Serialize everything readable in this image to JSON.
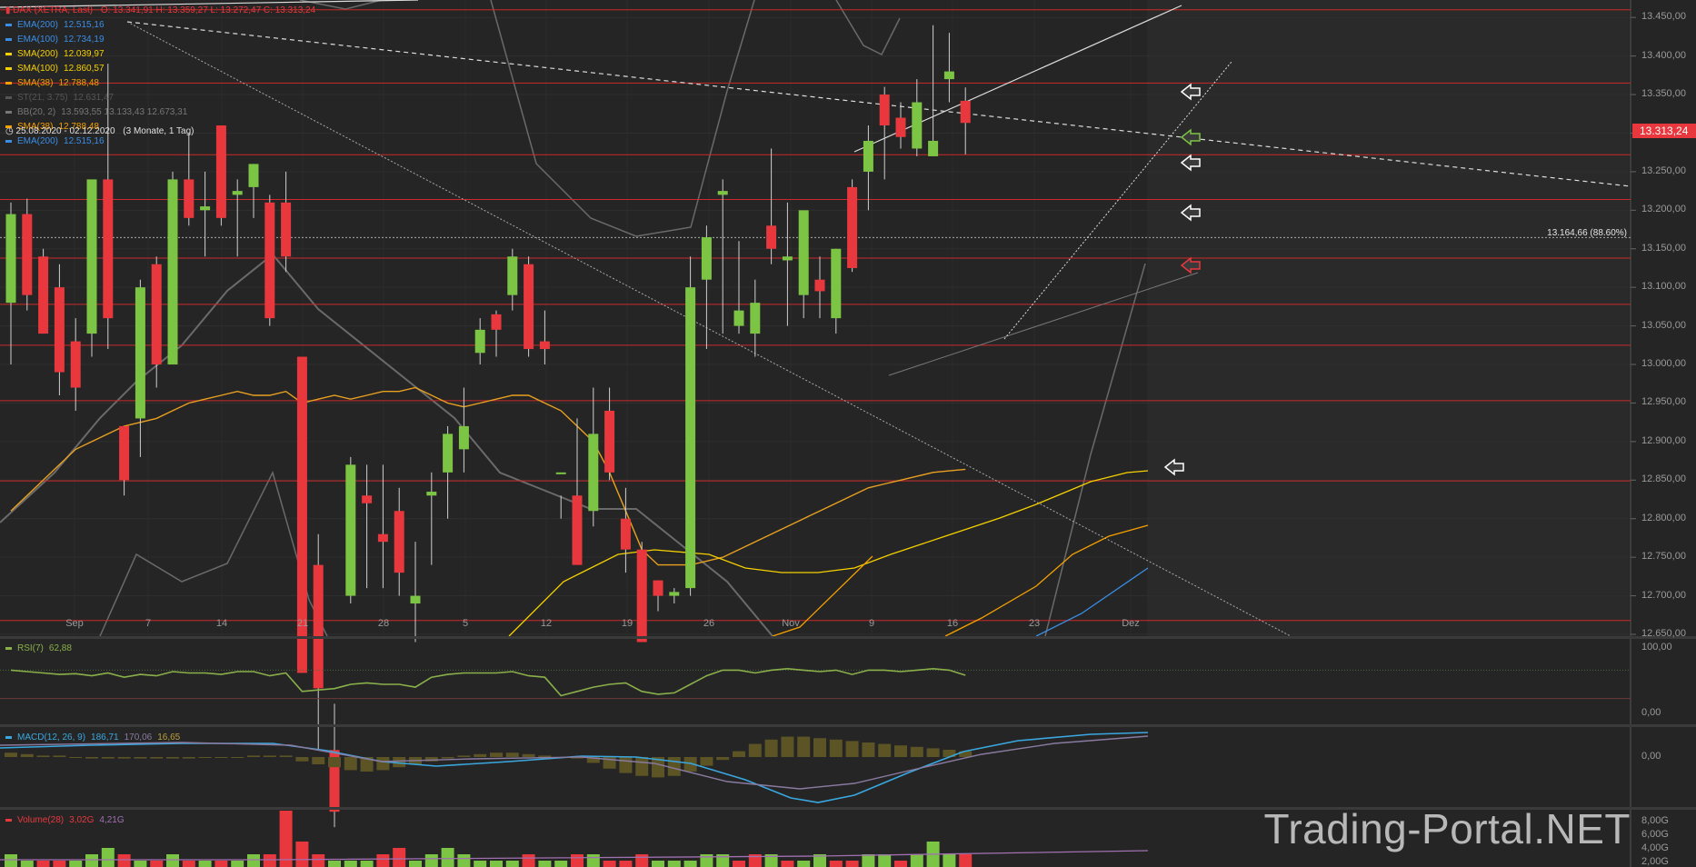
{
  "header": {
    "instrument": "DAX (XETRA, Last)",
    "ohlc": "O: 13.341,91  H: 13.359,27  L: 13.272,47  C: 13.313,24",
    "date_range": "25.08.2020 - 02.12.2020",
    "range_desc": "(3 Monate, 1 Tag)"
  },
  "indicators": [
    {
      "name": "EMA(200)",
      "value": "12.515,16",
      "color": "#3a8ee6"
    },
    {
      "name": "EMA(100)",
      "value": "12.734,19",
      "color": "#3a8ee6"
    },
    {
      "name": "SMA(200)",
      "value": "12.039,97",
      "color": "#f5d000"
    },
    {
      "name": "SMA(100)",
      "value": "12.860,57",
      "color": "#f5d000"
    },
    {
      "name": "SMA(38)",
      "value": "12.788,48",
      "color": "#f5a000"
    },
    {
      "name": "ST(21, 3.75)",
      "value": "12.631,47",
      "color": "#555555"
    },
    {
      "name": "BB(20, 2)",
      "value": "13.593,55  13.133,43  12.673,31",
      "color": "#777777"
    },
    {
      "name": "SMA(38)",
      "value": "12.788,48",
      "color": "#f5a000"
    },
    {
      "name": "EMA(200)",
      "value": "12.515,16",
      "color": "#3a8ee6"
    }
  ],
  "price_axis": {
    "ticks": [
      "13.450,00",
      "13.400,00",
      "13.350,00",
      "13.300,00",
      "13.250,00",
      "13.200,00",
      "13.150,00",
      "13.100,00",
      "13.050,00",
      "13.000,00",
      "12.950,00",
      "12.900,00",
      "12.850,00",
      "12.800,00",
      "12.750,00",
      "12.700,00",
      "12.650,00"
    ],
    "last_price": "13.313,24",
    "hline_label": "13.164,66 (88.60%)"
  },
  "date_axis": [
    "Sep",
    "7",
    "14",
    "21",
    "28",
    "5",
    "12",
    "19",
    "26",
    "Nov",
    "9",
    "16",
    "23",
    "Dez"
  ],
  "panels": {
    "rsi": {
      "name": "RSI(7)",
      "value": "62,88",
      "color": "#8ab04a",
      "ticks": [
        "100,00",
        "0,00"
      ]
    },
    "macd": {
      "name": "MACD(12, 26, 9)",
      "v1": "186,71",
      "v2": "170,06",
      "v3": "16,65",
      "c1": "#3aa8e0",
      "c2": "#8a7aa0",
      "c3": "#b8a040",
      "ticks": [
        "0,00"
      ]
    },
    "volume": {
      "name": "Volume(28)",
      "v1": "3,02G",
      "v2": "4,21G",
      "color": "#e8383d",
      "ticks": [
        "8,00G",
        "6,00G",
        "4,00G",
        "2,00G"
      ]
    }
  },
  "watermark": "Trading-Portal.NET",
  "chart_data": {
    "type": "candlestick",
    "title": "DAX (XETRA, Last)",
    "ylim": [
      12650,
      13480
    ],
    "candles": [
      {
        "o": 13080,
        "h": 13210,
        "l": 13000,
        "c": 13195
      },
      {
        "o": 13195,
        "h": 13215,
        "l": 13070,
        "c": 13090
      },
      {
        "o": 13140,
        "h": 13150,
        "l": 13040,
        "c": 13040
      },
      {
        "o": 13100,
        "h": 13130,
        "l": 12960,
        "c": 12990
      },
      {
        "o": 13030,
        "h": 13060,
        "l": 12940,
        "c": 12970
      },
      {
        "o": 13040,
        "h": 13230,
        "l": 13010,
        "c": 13240
      },
      {
        "o": 13240,
        "h": 13390,
        "l": 13020,
        "c": 13060
      },
      {
        "o": 12920,
        "h": 12900,
        "l": 12830,
        "c": 12850
      },
      {
        "o": 12930,
        "h": 13110,
        "l": 12880,
        "c": 13100
      },
      {
        "o": 13130,
        "h": 13140,
        "l": 12970,
        "c": 13000
      },
      {
        "o": 13000,
        "h": 13250,
        "l": 13000,
        "c": 13240
      },
      {
        "o": 13240,
        "h": 13300,
        "l": 13180,
        "c": 13190
      },
      {
        "o": 13200,
        "h": 13250,
        "l": 13140,
        "c": 13205
      },
      {
        "o": 13310,
        "h": 13310,
        "l": 13180,
        "c": 13190
      },
      {
        "o": 13220,
        "h": 13240,
        "l": 13140,
        "c": 13225
      },
      {
        "o": 13230,
        "h": 13260,
        "l": 13190,
        "c": 13260
      },
      {
        "o": 13210,
        "h": 13220,
        "l": 13050,
        "c": 13060
      },
      {
        "o": 13210,
        "h": 13250,
        "l": 13120,
        "c": 13140
      },
      {
        "o": 13010,
        "h": 12990,
        "l": 12600,
        "c": 12600
      },
      {
        "o": 12740,
        "h": 12780,
        "l": 12500,
        "c": 12580
      },
      {
        "o": 12500,
        "h": 12560,
        "l": 12400,
        "c": 12420
      },
      {
        "o": 12700,
        "h": 12880,
        "l": 12690,
        "c": 12870
      },
      {
        "o": 12830,
        "h": 12870,
        "l": 12710,
        "c": 12820
      },
      {
        "o": 12780,
        "h": 12870,
        "l": 12710,
        "c": 12770
      },
      {
        "o": 12810,
        "h": 12840,
        "l": 12700,
        "c": 12730
      },
      {
        "o": 12690,
        "h": 12770,
        "l": 12640,
        "c": 12700
      },
      {
        "o": 12830,
        "h": 12860,
        "l": 12740,
        "c": 12835
      },
      {
        "o": 12860,
        "h": 12920,
        "l": 12800,
        "c": 12910
      },
      {
        "o": 12890,
        "h": 12970,
        "l": 12860,
        "c": 12920
      },
      {
        "o": 13015,
        "h": 13060,
        "l": 13000,
        "c": 13045
      },
      {
        "o": 13065,
        "h": 13070,
        "l": 13010,
        "c": 13045
      },
      {
        "o": 13090,
        "h": 13150,
        "l": 13070,
        "c": 13140
      },
      {
        "o": 13130,
        "h": 13140,
        "l": 13010,
        "c": 13020
      },
      {
        "o": 13030,
        "h": 13070,
        "l": 13000,
        "c": 13020
      },
      {
        "o": 12860,
        "h": 12830,
        "l": 12800,
        "c": 12860
      },
      {
        "o": 12830,
        "h": 12930,
        "l": 12750,
        "c": 12740
      },
      {
        "o": 12810,
        "h": 12970,
        "l": 12790,
        "c": 12910
      },
      {
        "o": 12940,
        "h": 12970,
        "l": 12850,
        "c": 12860
      },
      {
        "o": 12800,
        "h": 12840,
        "l": 12730,
        "c": 12760
      },
      {
        "o": 12760,
        "h": 12770,
        "l": 12660,
        "c": 12640
      },
      {
        "o": 12720,
        "h": 12720,
        "l": 12680,
        "c": 12700
      },
      {
        "o": 12700,
        "h": 12710,
        "l": 12690,
        "c": 12705
      },
      {
        "o": 12710,
        "h": 13140,
        "l": 12700,
        "c": 13100
      },
      {
        "o": 13110,
        "h": 13180,
        "l": 13020,
        "c": 13165
      },
      {
        "o": 13220,
        "h": 13240,
        "l": 13040,
        "c": 13225
      },
      {
        "o": 13050,
        "h": 13160,
        "l": 13040,
        "c": 13070
      },
      {
        "o": 13040,
        "h": 13110,
        "l": 13010,
        "c": 13080
      },
      {
        "o": 13180,
        "h": 13280,
        "l": 13130,
        "c": 13150
      },
      {
        "o": 13135,
        "h": 13210,
        "l": 13050,
        "c": 13140
      },
      {
        "o": 13090,
        "h": 13140,
        "l": 13060,
        "c": 13200
      },
      {
        "o": 13110,
        "h": 13140,
        "l": 13060,
        "c": 13095
      },
      {
        "o": 13060,
        "h": 13150,
        "l": 13040,
        "c": 13150
      },
      {
        "o": 13230,
        "h": 13240,
        "l": 13120,
        "c": 13125
      },
      {
        "o": 13250,
        "h": 13310,
        "l": 13200,
        "c": 13290
      },
      {
        "o": 13350,
        "h": 13360,
        "l": 13240,
        "c": 13310
      },
      {
        "o": 13320,
        "h": 13340,
        "l": 13280,
        "c": 13295
      },
      {
        "o": 13280,
        "h": 13370,
        "l": 13270,
        "c": 13340
      },
      {
        "o": 13270,
        "h": 13440,
        "l": 13270,
        "c": 13290
      },
      {
        "o": 13370,
        "h": 13430,
        "l": 13340,
        "c": 13380
      },
      {
        "o": 13341.91,
        "h": 13359.27,
        "l": 13272.47,
        "c": 13313.24
      }
    ],
    "hlines": [
      13460,
      13365,
      13272,
      13214,
      13138,
      13078,
      13025,
      12953,
      12849,
      12668
    ],
    "sma38": [
      12810,
      12830,
      12850,
      12870,
      12890,
      12900,
      12910,
      12920,
      12925,
      12930,
      12940,
      12950,
      12955,
      12960,
      12965,
      12960,
      12960,
      12965,
      12950,
      12955,
      12960,
      12955,
      12960,
      12965,
      12965,
      12970,
      12960,
      12950,
      12945,
      12950,
      12955,
      12960,
      12960,
      12950,
      12940,
      12920,
      12900,
      12860,
      12810,
      12760,
      12740,
      12740,
      12740,
      12745,
      12750,
      12760,
      12770,
      12780,
      12790,
      12800,
      12810,
      12820,
      12830,
      12840,
      12845,
      12850,
      12855,
      12860,
      12862,
      12864
    ],
    "ema200": [],
    "rsi": [
      70,
      68,
      66,
      64,
      65,
      62,
      66,
      60,
      64,
      62,
      68,
      66,
      66,
      64,
      68,
      68,
      62,
      66,
      40,
      42,
      44,
      50,
      52,
      50,
      50,
      46,
      60,
      64,
      66,
      66,
      66,
      68,
      62,
      60,
      34,
      40,
      46,
      50,
      52,
      40,
      36,
      38,
      50,
      62,
      70,
      70,
      66,
      70,
      72,
      70,
      68,
      70,
      64,
      70,
      70,
      68,
      70,
      72,
      70,
      62.88
    ]
  }
}
